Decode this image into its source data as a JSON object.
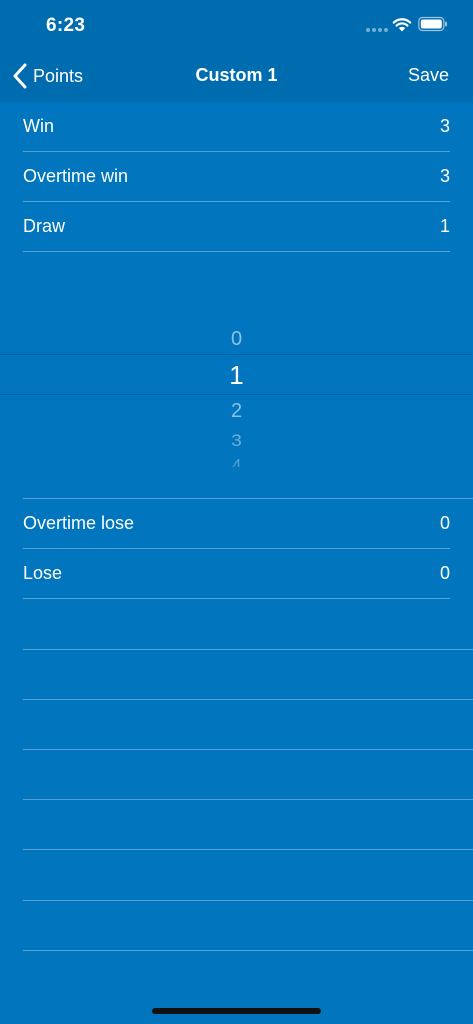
{
  "status_bar": {
    "time": "6:23"
  },
  "nav": {
    "back_label": "Points",
    "title": "Custom 1",
    "save_label": "Save"
  },
  "rows_top": [
    {
      "label": "Win",
      "value": "3"
    },
    {
      "label": "Overtime win",
      "value": "3"
    },
    {
      "label": "Draw",
      "value": "1"
    }
  ],
  "picker": {
    "options": [
      "0",
      "1",
      "2",
      "3",
      "4"
    ],
    "selected": "1"
  },
  "rows_bottom": [
    {
      "label": "Overtime lose",
      "value": "0"
    },
    {
      "label": "Lose",
      "value": "0"
    }
  ],
  "colors": {
    "background": "#0175BD",
    "nav_background": "#006CB0",
    "text": "#FFFFFF"
  }
}
